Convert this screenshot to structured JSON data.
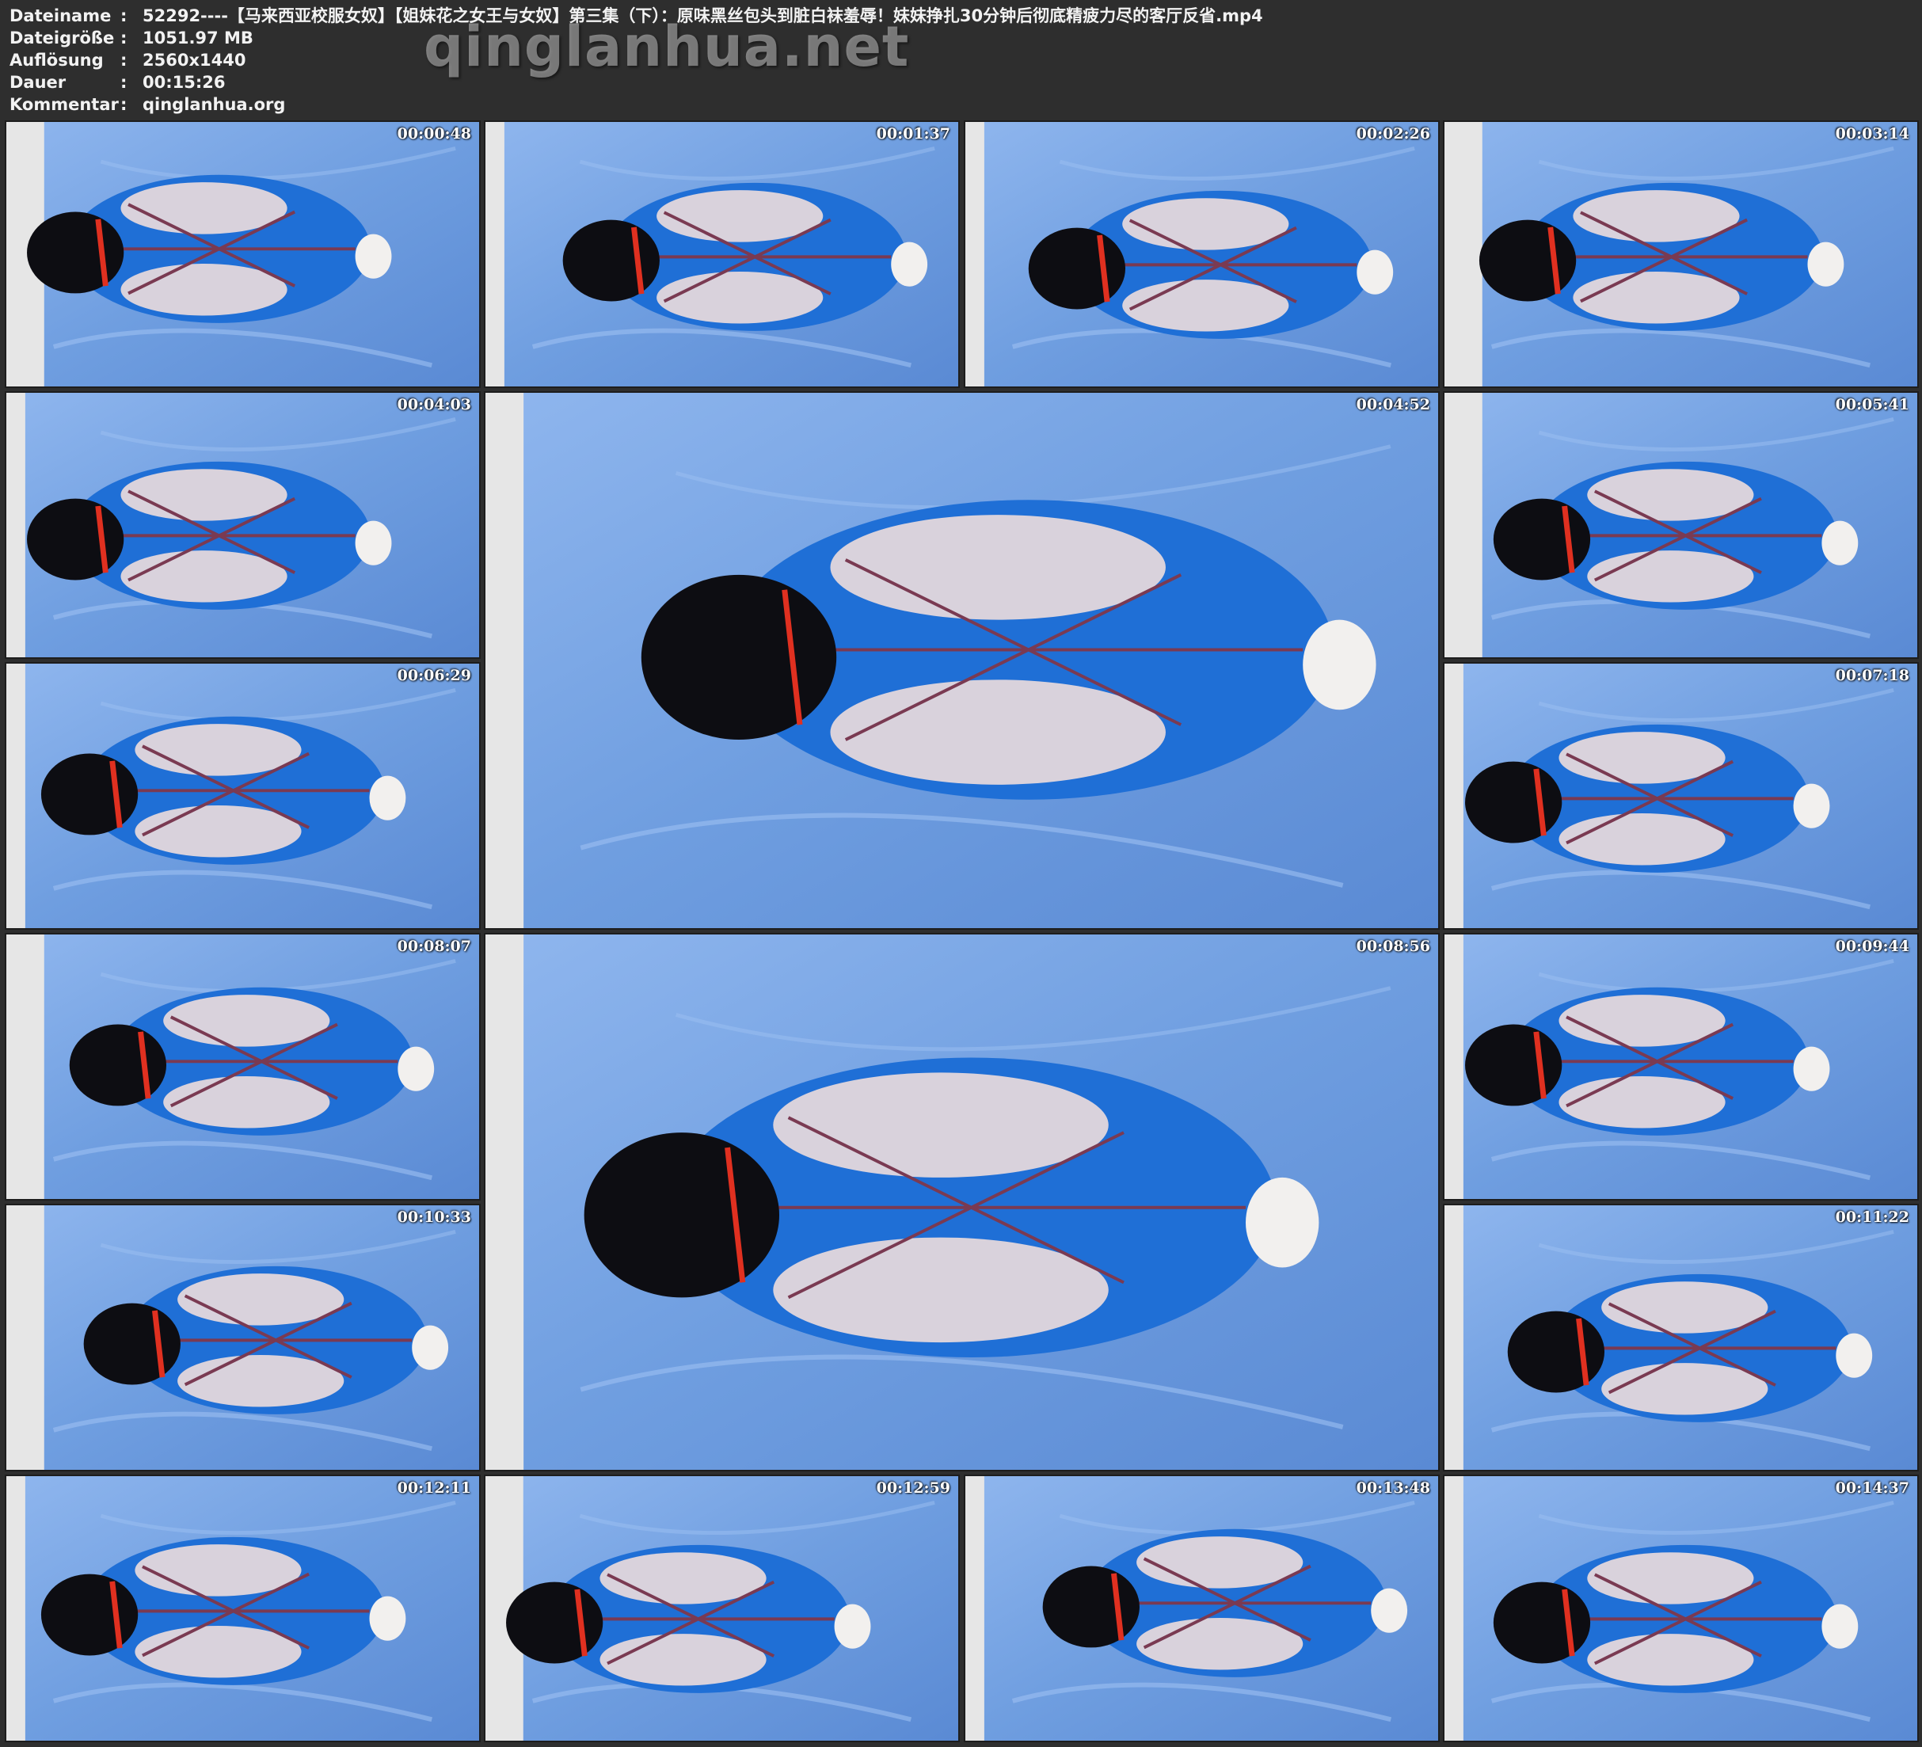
{
  "header": {
    "rows": [
      {
        "label": "Dateiname",
        "sep": ":",
        "value": "52292----【马来西亚校服女奴】【姐妹花之女王与女奴】第三集（下）：原味黑丝包头到脏白袜羞辱！妹妹挣扎30分钟后彻底精疲力尽的客厅反省.mp4"
      },
      {
        "label": "Dateigröße",
        "sep": ":",
        "value": "1051.97 MB"
      },
      {
        "label": "Auflösung",
        "sep": ":",
        "value": "2560x1440"
      },
      {
        "label": "Dauer",
        "sep": ":",
        "value": "00:15:26"
      },
      {
        "label": "Kommentar",
        "sep": ":",
        "value": "qinglanhua.org"
      }
    ],
    "watermark": "qinglanhua.net"
  },
  "thumbnails": [
    {
      "timestamp": "00:00:48"
    },
    {
      "timestamp": "00:01:37"
    },
    {
      "timestamp": "00:02:26"
    },
    {
      "timestamp": "00:03:14"
    },
    {
      "timestamp": "00:04:03"
    },
    {
      "timestamp": "00:04:52"
    },
    {
      "timestamp": "00:05:41"
    },
    {
      "timestamp": "00:06:29"
    },
    {
      "timestamp": "00:07:18"
    },
    {
      "timestamp": "00:08:07"
    },
    {
      "timestamp": "00:08:56"
    },
    {
      "timestamp": "00:09:44"
    },
    {
      "timestamp": "00:10:33"
    },
    {
      "timestamp": "00:11:22"
    },
    {
      "timestamp": "00:12:11"
    },
    {
      "timestamp": "00:12:59"
    },
    {
      "timestamp": "00:13:48"
    },
    {
      "timestamp": "00:14:37"
    }
  ],
  "colors": {
    "background": "#2e2e2e",
    "sheet": "#6f9ee0",
    "uniform": "#1f6fd6",
    "shirt": "#d9d2dc",
    "rope": "#7a3a52",
    "strap": "#e03020",
    "hood": "#0d0d12",
    "floor": "#e6e6e6"
  }
}
